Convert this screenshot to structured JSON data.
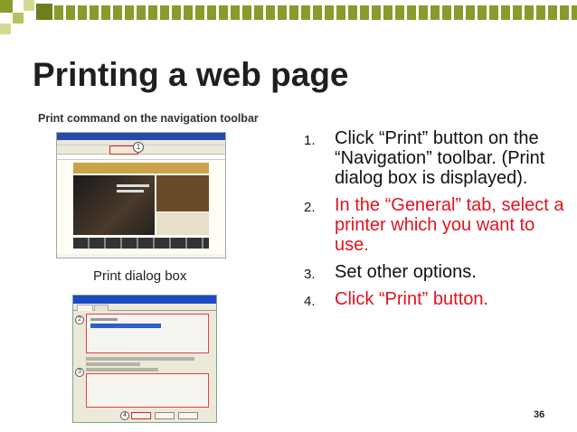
{
  "slide": {
    "title": "Printing a web page",
    "page_number": "36",
    "colors": {
      "accent_green": "#8a9a2b",
      "highlight_red": "#e0141e",
      "text": "#111111"
    }
  },
  "figures": {
    "caption_top": "Print command on the navigation toolbar",
    "caption_bottom": "Print dialog box",
    "badge_top": "1",
    "badges_dialog": [
      "2",
      "3",
      "4"
    ]
  },
  "steps": [
    {
      "number": "1.",
      "text": "Click “Print” button on the “Navigation” toolbar.   (Print dialog box is displayed).",
      "color": "#111111"
    },
    {
      "number": "2.",
      "text": "In the “General” tab, select a printer which you want to use.",
      "color": "#e0141e"
    },
    {
      "number": "3.",
      "text": "Set other options.",
      "color": "#111111"
    },
    {
      "number": "4.",
      "text": "Click “Print” button.",
      "color": "#e0141e"
    }
  ]
}
